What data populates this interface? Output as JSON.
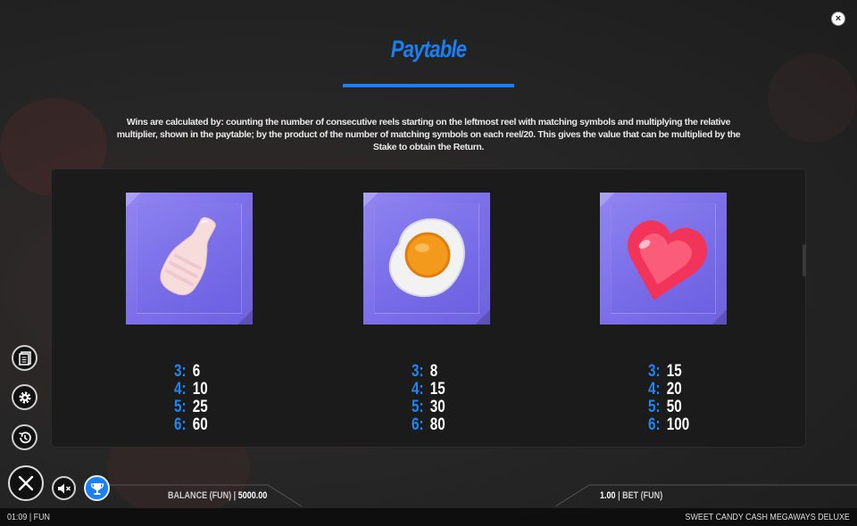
{
  "header": {
    "title": "Paytable",
    "close_label": "×"
  },
  "description": "Wins are calculated by: counting the number of consecutive reels starting on the leftmost reel with matching symbols and multiplying the relative multiplier, shown in the paytable; by the product of the number of matching symbols on each reel/20. This gives the value that can be multiplied by the Stake to obtain the Return.",
  "symbols": [
    {
      "icon": "candy-bottle-icon",
      "pays": [
        {
          "count": "3:",
          "value": "6"
        },
        {
          "count": "4:",
          "value": "10"
        },
        {
          "count": "5:",
          "value": "25"
        },
        {
          "count": "6:",
          "value": "60"
        }
      ]
    },
    {
      "icon": "fried-egg-candy-icon",
      "pays": [
        {
          "count": "3:",
          "value": "8"
        },
        {
          "count": "4:",
          "value": "15"
        },
        {
          "count": "5:",
          "value": "30"
        },
        {
          "count": "6:",
          "value": "80"
        }
      ]
    },
    {
      "icon": "heart-jelly-icon",
      "pays": [
        {
          "count": "3:",
          "value": "15"
        },
        {
          "count": "4:",
          "value": "20"
        },
        {
          "count": "5:",
          "value": "50"
        },
        {
          "count": "6:",
          "value": "100"
        }
      ]
    }
  ],
  "side_menu": [
    {
      "icon": "paytable-icon"
    },
    {
      "icon": "settings-icon"
    },
    {
      "icon": "history-icon"
    }
  ],
  "controls": {
    "close_icon": "close-icon",
    "mute_icon": "mute-icon",
    "trophy_icon": "trophy-icon"
  },
  "balance": {
    "label": "BALANCE (FUN) |",
    "value": "5000.00"
  },
  "bet": {
    "value": "1.00",
    "label": "| BET (FUN)"
  },
  "footer": {
    "left": "01:09 | FUN",
    "right": "SWEET CANDY CASH MEGAWAYS DELUXE"
  },
  "colors": {
    "accent": "#1a7ff2",
    "tile": "#7a6de8",
    "panel": "#1b1b1b"
  }
}
